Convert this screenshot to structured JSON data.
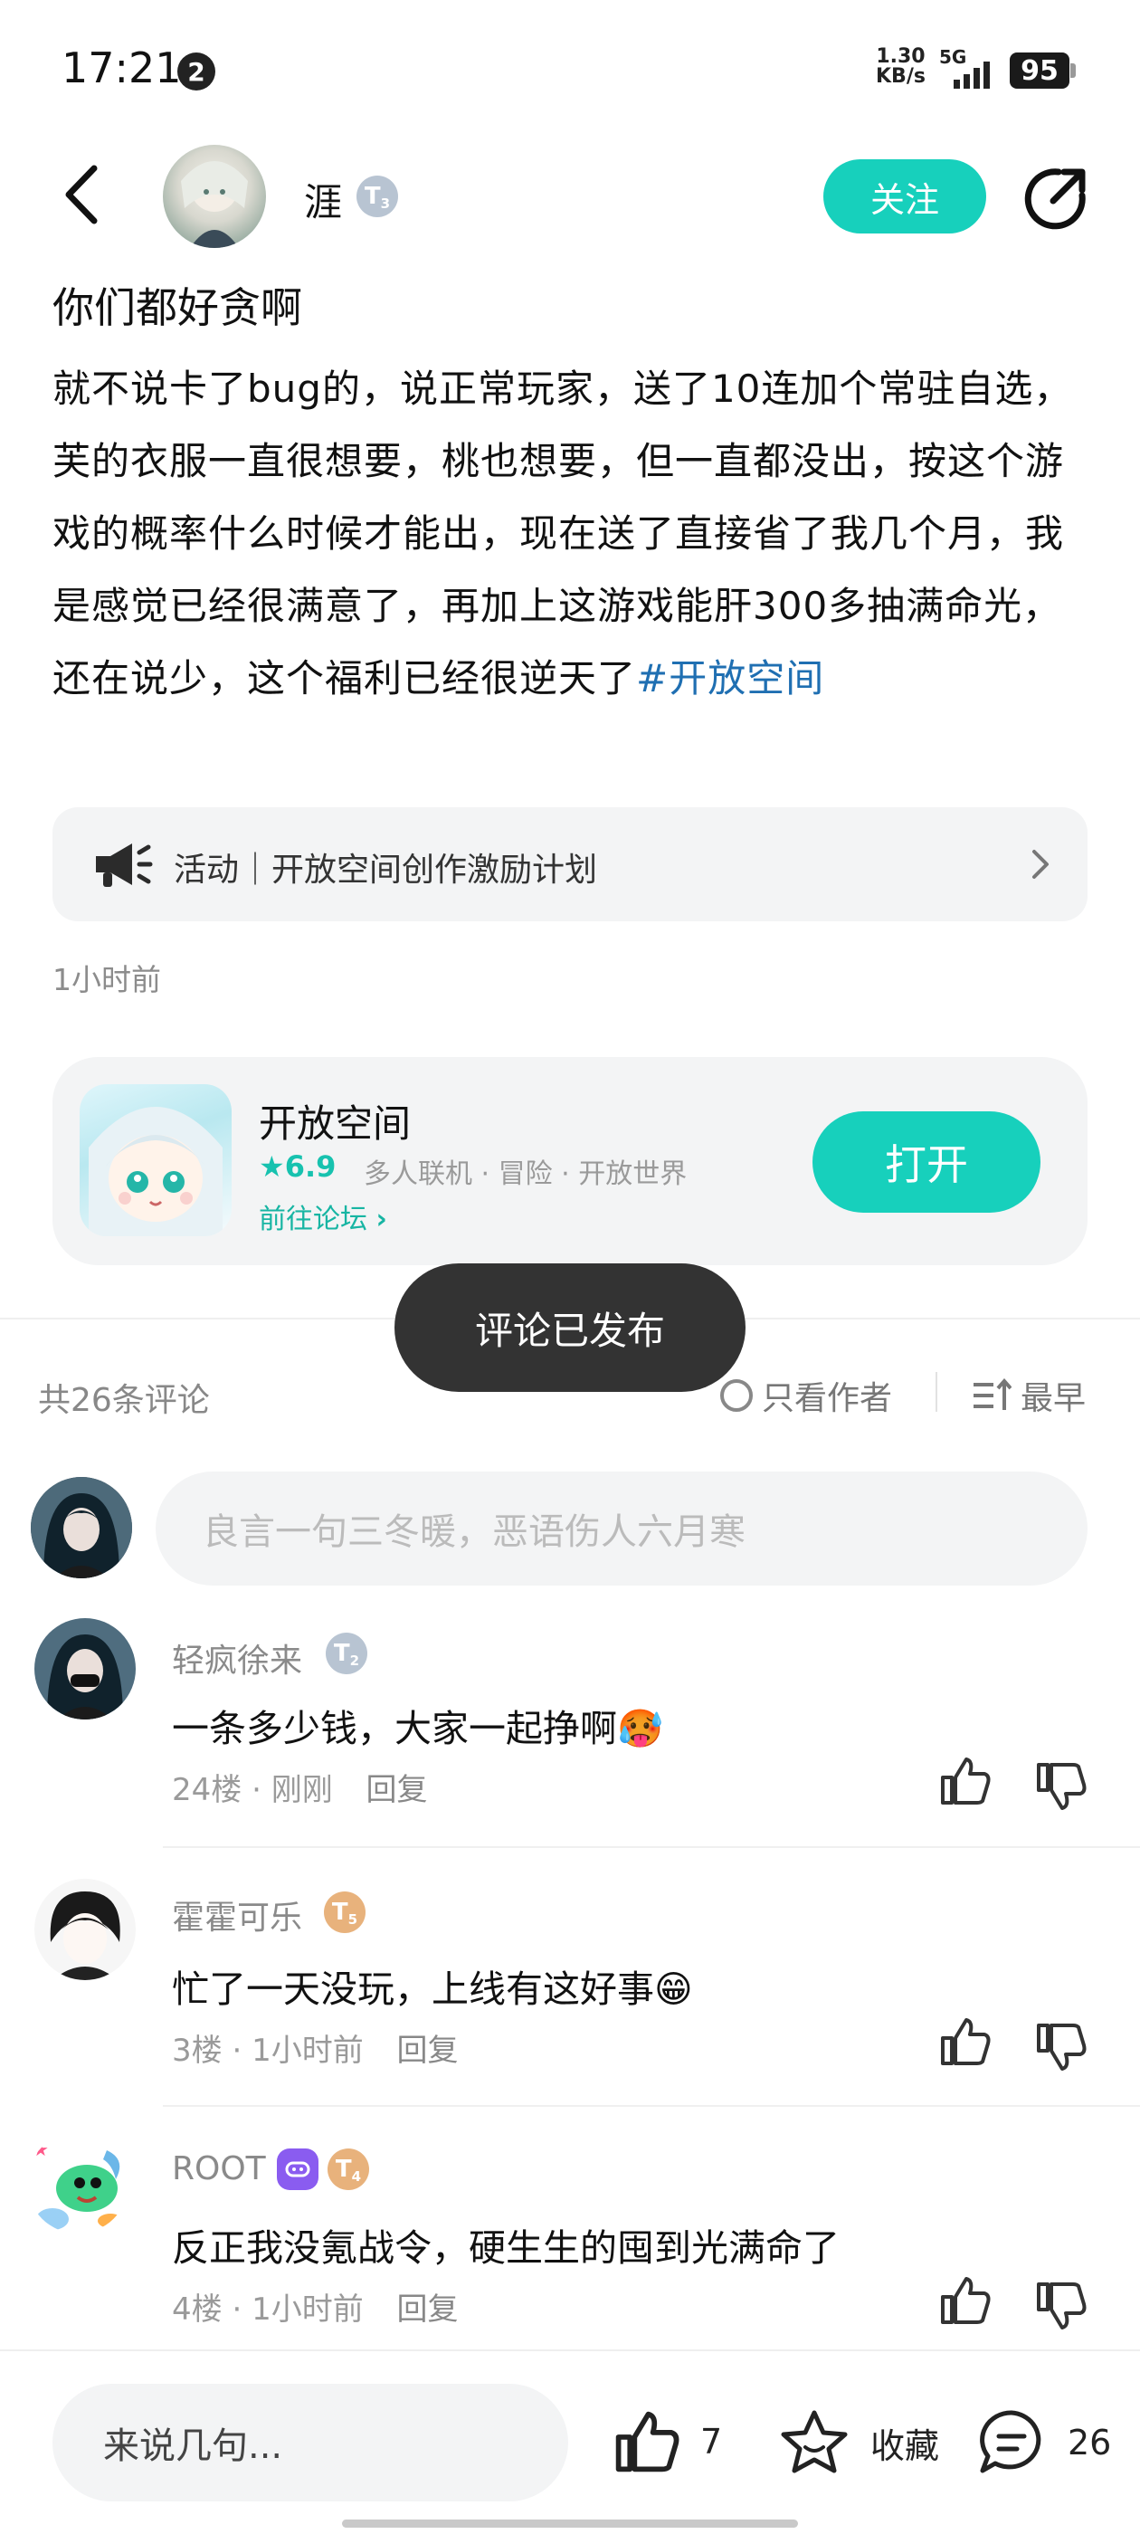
{
  "status_bar": {
    "time": "17:21",
    "notification_count": "2",
    "net_speed_value": "1.30",
    "net_speed_unit": "KB/s",
    "network": "5G",
    "battery": "95"
  },
  "header": {
    "author_name": "涯",
    "author_level": "T",
    "author_level_num": "3",
    "follow_label": "关注"
  },
  "post": {
    "title": "你们都好贪啊",
    "body": "就不说卡了bug的，说正常玩家，送了10连加个常驻自选，芙的衣服一直很想要，桃也想要，但一直都没出，按这个游戏的概率什么时候才能出，现在送了直接省了我几个月，我是感觉已经很满意了，再加上这游戏能肝300多抽满命光，还在说少，这个福利已经很逆天了",
    "hashtag": "#开放空间",
    "activity": "活动｜开放空间创作激励计划",
    "time": "1小时前"
  },
  "game_card": {
    "name": "开放空间",
    "rating": "★6.9",
    "tags": "多人联机 · 冒险 · 开放世界",
    "forum_link": "前往论坛",
    "open_label": "打开"
  },
  "toast": "评论已发布",
  "comments_section": {
    "count_label": "共26条评论",
    "author_only_label": "只看作者",
    "sort_label": "最早",
    "input_placeholder": "良言一句三冬暖，恶语伤人六月寒"
  },
  "comments": [
    {
      "user": "轻疯徐来",
      "level": "T",
      "level_num": "2",
      "text": "一条多少钱，大家一起挣啊",
      "emoji": "🥵",
      "floor": "24楼",
      "time": "刚刚",
      "reply": "回复"
    },
    {
      "user": "霍霍可乐",
      "level": "T",
      "level_num": "5",
      "text": "忙了一天没玩，上线有这好事",
      "emoji": "😁",
      "floor": "3楼",
      "time": "1小时前",
      "reply": "回复"
    },
    {
      "user": "ROOT",
      "level": "T",
      "level_num": "4",
      "text": "反正我没氪战令，硬生生的囤到光满命了",
      "emoji": "",
      "floor": "4楼",
      "time": "1小时前",
      "reply": "回复"
    }
  ],
  "bottom_bar": {
    "input_placeholder": "来说几句...",
    "likes": "7",
    "favorite_label": "收藏",
    "comments": "26"
  },
  "colors": {
    "accent": "#17d0bc",
    "hashtag": "#1f6fb2",
    "card_bg": "#f3f4f5"
  }
}
